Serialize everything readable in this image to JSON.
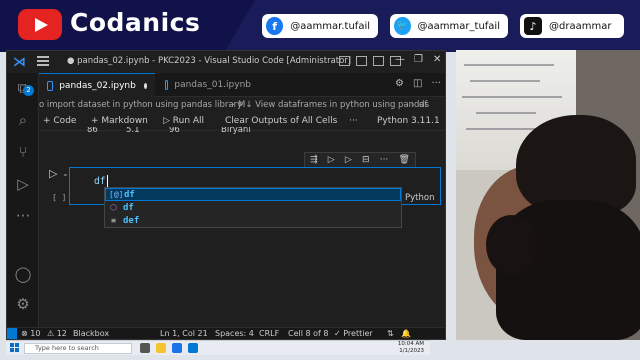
{
  "banner": {
    "brand": "Codanics",
    "facebook": "@aammar.tufail",
    "twitter": "@aammar_tufail",
    "tiktok": "@draammar"
  },
  "titlebar": {
    "title": "● pandas_02.ipynb - PKC2023 - Visual Studio Code [Administrator]"
  },
  "activity": {
    "badge": "2"
  },
  "tabs": [
    {
      "label": "pandas_02.ipynb",
      "active": true
    },
    {
      "label": "pandas_01.ipynb",
      "active": false
    }
  ],
  "breadcrumb": {
    "part1": "o import dataset in python using pandas library",
    "part2": "M↓ View dataframes in python using pandas",
    "part3": "df"
  },
  "toolbar": {
    "code": "+ Code",
    "markdown": "+ Markdown",
    "run_all": "▷ Run All",
    "clear_outputs": "Clear Outputs of All Cells",
    "more": "···",
    "kernel": "Python 3.11.1"
  },
  "previous_output": {
    "c1": "86",
    "c2": "5.1",
    "c3": "96",
    "c4": "Biryani"
  },
  "cell": {
    "code": "df",
    "exec_count": "[ ]",
    "language": "Python"
  },
  "suggestions": [
    {
      "icon": "[@]",
      "label": "df",
      "selected": true
    },
    {
      "icon": "⬡",
      "label": "df",
      "selected": false
    },
    {
      "icon": "≡",
      "label": "def",
      "selected": false
    }
  ],
  "statusbar": {
    "errors": "⊗ 10",
    "warnings": "⚠ 12",
    "blackbox": "Blackbox",
    "position": "Ln 1, Col 21",
    "spaces": "Spaces: 4",
    "eol": "CRLF",
    "cell": "Cell 8 of 8",
    "prettier": "✓ Prettier"
  },
  "taskbar": {
    "search_placeholder": "Type here to search",
    "time": "10:04 AM",
    "date": "1/1/2023"
  },
  "colors": {
    "accent": "#0078d4",
    "editor_bg": "#1f1f1f",
    "banner_bg": "#1a1c5a",
    "youtube_red": "#e52421"
  }
}
